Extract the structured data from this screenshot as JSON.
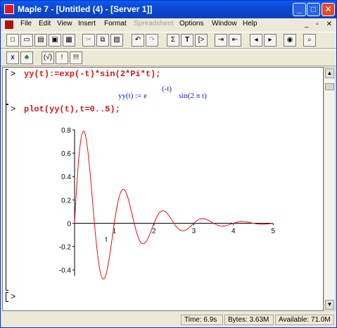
{
  "window": {
    "title": "Maple 7 - [Untitled (4) - [Server 1]]"
  },
  "menu": {
    "items": [
      "File",
      "Edit",
      "View",
      "Insert",
      "Format",
      "Spreadsheet",
      "Options",
      "Window",
      "Help"
    ],
    "disabled": [
      "Spreadsheet"
    ]
  },
  "toolbar1": {
    "buttons": [
      "new-icon",
      "open-icon",
      "open-url-icon",
      "save-icon",
      "print-icon",
      "cut-icon",
      "copy-icon",
      "paste-icon",
      "undo-icon",
      "redo-icon",
      "sigma-icon",
      "text-T-icon",
      "insert-region-icon",
      "indent-icon",
      "outdent-icon",
      "back-icon",
      "forward-icon",
      "stop-icon",
      "zoom-icon"
    ],
    "sigma": "Σ",
    "text": "T",
    "region": "[>"
  },
  "toolbar2": {
    "labels": [
      "x",
      "♣",
      "(√)",
      "!",
      "!!!"
    ]
  },
  "worksheet": {
    "prompt": ">",
    "input1": "yy(t):=exp(-t)*sin(2*Pi*t);",
    "output_lhs": "yy(t) := e",
    "output_exp": "(-t)",
    "output_rhs": "sin(2 π t)",
    "input2": "plot(yy(t),t=0..5);",
    "empty_prompt": ">"
  },
  "chart_data": {
    "type": "line",
    "function": "exp(-t)*sin(2*Pi*t)",
    "xlabel": "t",
    "xlim": [
      0,
      5
    ],
    "ylim": [
      -0.45,
      0.8
    ],
    "xticks": [
      1,
      2,
      3,
      4,
      5
    ],
    "yticks": [
      0.8,
      0.6,
      0.4,
      0.2,
      0,
      -0.2,
      -0.4
    ],
    "ytick_labels": [
      "0.8",
      "0.6",
      "0.4",
      "0.2",
      "0",
      "-0.2",
      "-0.4"
    ],
    "color": "#e01010"
  },
  "status": {
    "time": "Time:  6.9s",
    "bytes": "Bytes: 3.63M",
    "available": "Available: 71.0M"
  }
}
